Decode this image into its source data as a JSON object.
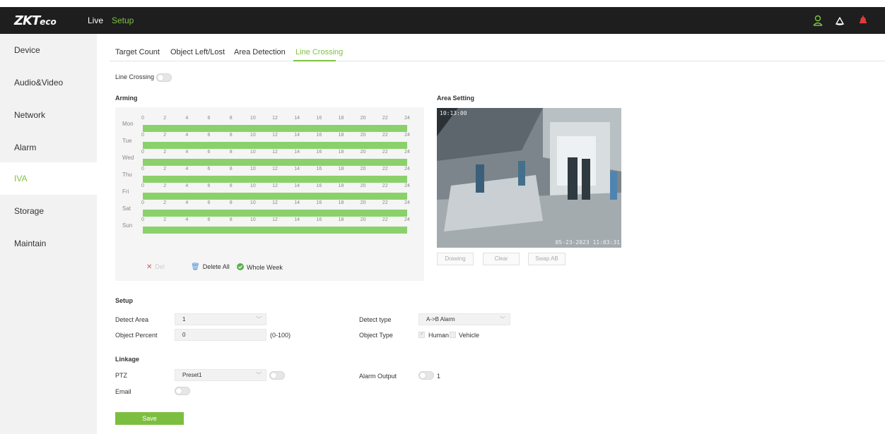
{
  "header": {
    "logo_main": "ZKT",
    "logo_sub": "eco",
    "nav": {
      "live": "Live",
      "setup": "Setup"
    },
    "icons": [
      "user-icon",
      "cloud-icon",
      "alarm-bell-icon"
    ],
    "accent_color": "#7fc241"
  },
  "sidebar": {
    "items": [
      {
        "label": "Device"
      },
      {
        "label": "Audio&Video"
      },
      {
        "label": "Network"
      },
      {
        "label": "Alarm"
      },
      {
        "label": "IVA",
        "active": true
      },
      {
        "label": "Storage"
      },
      {
        "label": "Maintain"
      }
    ]
  },
  "tabs": [
    {
      "label": "Target Count"
    },
    {
      "label": "Object Left/Lost"
    },
    {
      "label": "Area Detection"
    },
    {
      "label": "Line Crossing",
      "active": true
    }
  ],
  "line_crossing": {
    "label": "Line Crossing",
    "enabled": false
  },
  "arming": {
    "title": "Arming",
    "days": [
      "Mon",
      "Tue",
      "Wed",
      "Thu",
      "Fri",
      "Sat",
      "Sun"
    ],
    "hours": [
      "0",
      "2",
      "4",
      "6",
      "8",
      "10",
      "12",
      "14",
      "16",
      "18",
      "20",
      "22",
      "24"
    ],
    "armed_fraction": 1.0,
    "buttons": {
      "del": "Del",
      "delete_all": "Delete All",
      "whole_week": "Whole Week"
    }
  },
  "area_setting": {
    "title": "Area Setting",
    "video_overlay_tl": "10:13:00",
    "video_overlay_br": "05-23-2023 11:03:31",
    "buttons": {
      "drawing": "Drawing",
      "clear": "Clear",
      "swap": "Swap AB"
    }
  },
  "setup": {
    "title": "Setup",
    "detect_area_label": "Detect Area",
    "detect_area_value": "1",
    "object_percent_label": "Object Percent",
    "object_percent_value": "0",
    "object_percent_range": "(0-100)",
    "detect_type_label": "Detect type",
    "detect_type_value": "A->B Alarm",
    "object_type_label": "Object Type",
    "object_type_options": [
      {
        "label": "Human",
        "checked": true
      },
      {
        "label": "Vehicle",
        "checked": false
      }
    ]
  },
  "linkage": {
    "title": "Linkage",
    "ptz_label": "PTZ",
    "ptz_value": "Preset1",
    "email_label": "Email",
    "alarm_output_label": "Alarm Output",
    "alarm_output_value": "1"
  },
  "save_label": "Save"
}
